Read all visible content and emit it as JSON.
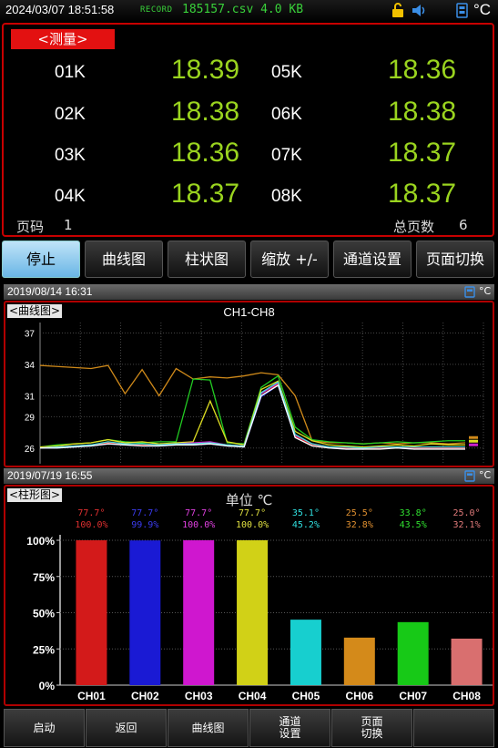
{
  "status": {
    "datetime": "2024/03/07  18:51:58",
    "record_label": "RECORD",
    "record_file": "185157.csv  4.0 KB",
    "unit": "°C",
    "icons": [
      "unlock-icon",
      "speaker-icon",
      "usb-icon"
    ]
  },
  "measure": {
    "title": "<测量>",
    "channels": [
      {
        "name": "01K",
        "value": "18.39"
      },
      {
        "name": "02K",
        "value": "18.38"
      },
      {
        "name": "03K",
        "value": "18.36"
      },
      {
        "name": "04K",
        "value": "18.37"
      },
      {
        "name": "05K",
        "value": "18.36"
      },
      {
        "name": "06K",
        "value": "18.38"
      },
      {
        "name": "07K",
        "value": "18.37"
      },
      {
        "name": "08K",
        "value": "18.37"
      }
    ],
    "page_label": "页码",
    "page_value": "1",
    "total_label": "总页数",
    "total_value": "6",
    "value_color": "#9ad41f"
  },
  "softkeys": [
    {
      "label": "停止",
      "active": true
    },
    {
      "label": "曲线图",
      "active": false
    },
    {
      "label": "柱状图",
      "active": false
    },
    {
      "label": "缩放 +/-",
      "active": false
    },
    {
      "label": "通道设置",
      "active": false
    },
    {
      "label": "页面切换",
      "active": false
    }
  ],
  "curve": {
    "datetime": "2019/08/14 16:31",
    "unit": "°C",
    "tag": "<曲线图>",
    "title": "CH1-CH8",
    "yticks": [
      "37",
      "34",
      "31",
      "29",
      "26"
    ]
  },
  "bar": {
    "datetime": "2019/07/19 16:55",
    "unit": "°C",
    "tag": "<柱形图>",
    "title": "单位 ℃",
    "yticks": [
      "100%",
      "75%",
      "50%",
      "25%",
      "0%"
    ]
  },
  "chart_data": [
    {
      "type": "line",
      "title": "CH1-CH8",
      "ylim": [
        24.5,
        38
      ],
      "yticks": [
        37,
        34,
        31,
        29,
        26
      ],
      "x": [
        0,
        4,
        8,
        12,
        16,
        20,
        24,
        28,
        32,
        36,
        40,
        44,
        48,
        52,
        56,
        60,
        64,
        68,
        72,
        76,
        80,
        84,
        88,
        92,
        96,
        100
      ],
      "series": [
        {
          "color": "#d08a1a",
          "values": [
            33.9,
            33.8,
            33.7,
            33.6,
            33.9,
            31.2,
            33.5,
            31.0,
            33.6,
            32.6,
            32.8,
            32.7,
            32.9,
            33.2,
            33.0,
            31.0,
            26.7,
            26.5,
            26.5,
            26.4,
            26.5,
            26.4,
            26.5,
            26.5,
            26.4,
            26.5
          ]
        },
        {
          "color": "#22cc22",
          "values": [
            26.1,
            26.3,
            26.4,
            26.5,
            26.8,
            26.6,
            26.5,
            26.6,
            26.6,
            32.6,
            32.5,
            26.5,
            26.4,
            31.8,
            32.9,
            28.0,
            26.8,
            26.6,
            26.5,
            26.4,
            26.5,
            26.6,
            26.5,
            26.6,
            26.7,
            26.7
          ]
        },
        {
          "color": "#dddd22",
          "values": [
            26.1,
            26.2,
            26.4,
            26.5,
            26.8,
            26.5,
            26.6,
            26.4,
            26.5,
            26.6,
            30.5,
            26.6,
            26.3,
            31.6,
            32.4,
            27.6,
            26.7,
            26.3,
            26.2,
            26.1,
            26.2,
            26.3,
            26.2,
            26.4,
            26.3,
            26.3
          ]
        },
        {
          "color": "#cc22cc",
          "values": [
            26.0,
            26.1,
            26.2,
            26.3,
            26.5,
            26.4,
            26.3,
            26.3,
            26.4,
            26.5,
            26.6,
            26.3,
            26.2,
            31.2,
            32.2,
            27.2,
            26.4,
            26.1,
            26.0,
            26.0,
            26.1,
            26.1,
            26.0,
            26.1,
            26.1,
            26.1
          ]
        },
        {
          "color": "#3344ff",
          "values": [
            26.0,
            26.0,
            26.1,
            26.2,
            26.4,
            26.3,
            26.2,
            26.2,
            26.3,
            26.3,
            26.4,
            26.2,
            26.1,
            30.9,
            32.0,
            27.0,
            26.3,
            26.0,
            25.9,
            25.9,
            26.0,
            26.0,
            25.9,
            26.0,
            26.0,
            26.0
          ]
        },
        {
          "color": "#dd3333",
          "values": [
            26.0,
            26.1,
            26.2,
            26.3,
            26.5,
            26.4,
            26.3,
            26.3,
            26.4,
            26.4,
            26.5,
            26.3,
            26.2,
            31.0,
            32.1,
            27.1,
            26.3,
            26.0,
            26.0,
            25.9,
            26.0,
            26.0,
            26.0,
            26.0,
            26.0,
            26.0
          ]
        },
        {
          "color": "#44dddd",
          "values": [
            26.0,
            26.1,
            26.2,
            26.3,
            26.6,
            26.4,
            26.4,
            26.3,
            26.4,
            26.4,
            26.5,
            26.3,
            26.2,
            31.3,
            32.3,
            27.3,
            26.4,
            26.1,
            26.1,
            26.0,
            26.1,
            26.1,
            26.1,
            26.1,
            26.1,
            26.1
          ]
        },
        {
          "color": "#ffffff",
          "values": [
            26.0,
            26.0,
            26.1,
            26.2,
            26.4,
            26.3,
            26.2,
            26.2,
            26.3,
            26.3,
            26.4,
            26.2,
            26.1,
            31.0,
            32.0,
            27.0,
            26.2,
            26.0,
            25.9,
            25.9,
            25.9,
            26.0,
            25.9,
            25.9,
            25.9,
            25.9
          ]
        }
      ]
    },
    {
      "type": "bar",
      "title": "单位 ℃",
      "ylim": [
        0,
        100
      ],
      "categories": [
        "CH01",
        "CH02",
        "CH03",
        "CH04",
        "CH05",
        "CH06",
        "CH07",
        "CH08"
      ],
      "values": [
        100.0,
        99.9,
        100.0,
        100.0,
        45.2,
        32.8,
        43.5,
        32.1
      ],
      "value_labels": [
        "100.0%",
        "99.9%",
        "100.0%",
        "100.0%",
        "45.2%",
        "32.8%",
        "43.5%",
        "32.1%"
      ],
      "temp_labels": [
        "77.7°",
        "77.7°",
        "77.7°",
        "77.7°",
        "35.1°",
        "25.5°",
        "33.8°",
        "25.0°"
      ],
      "colors": [
        "#d31a1a",
        "#1a1ad4",
        "#cf17cf",
        "#d1d117",
        "#17cfcf",
        "#d48a1a",
        "#17c917",
        "#d96f6f"
      ],
      "label_colors": [
        "#e03030",
        "#3b3bf0",
        "#e040e0",
        "#e0e040",
        "#30e0e0",
        "#e09030",
        "#30e030",
        "#e07a7a"
      ]
    }
  ],
  "bottom_buttons": [
    {
      "label": "启动"
    },
    {
      "label": "返回"
    },
    {
      "label": "曲线图"
    },
    {
      "label": "通道\n设置"
    },
    {
      "label": "页面\n切换"
    },
    {
      "label": ""
    }
  ]
}
